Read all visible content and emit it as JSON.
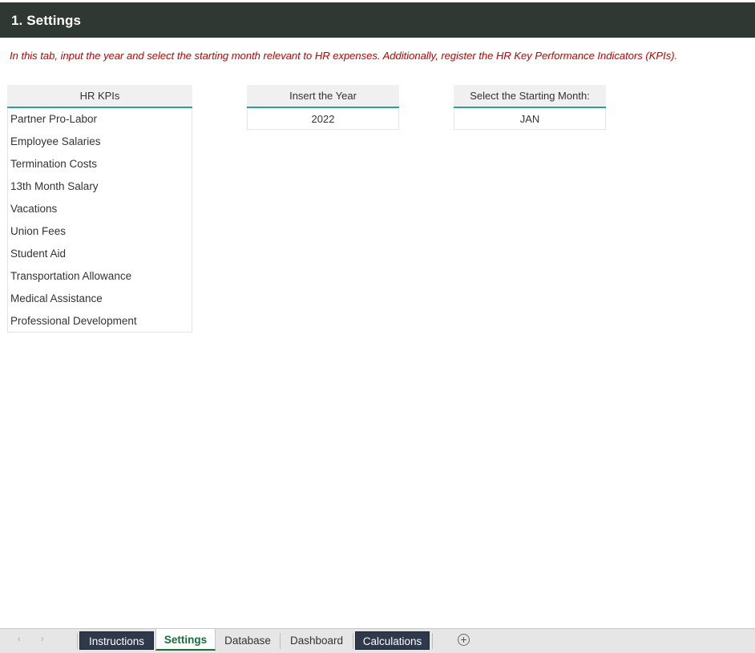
{
  "header": {
    "title": "1. Settings"
  },
  "instructions": "In this tab, input the year and select the starting month relevant to HR expenses. Additionally, register the HR Key Performance Indicators (KPIs).",
  "kpi_table": {
    "header": "HR KPIs",
    "items": [
      "Partner Pro-Labor",
      "Employee Salaries",
      "Termination Costs",
      "13th Month Salary",
      "Vacations",
      "Union Fees",
      "Student Aid",
      "Transportation Allowance",
      "Medical Assistance",
      "Professional Development"
    ]
  },
  "year_field": {
    "header": "Insert the Year",
    "value": "2022"
  },
  "month_field": {
    "header": "Select the Starting Month:",
    "value": "JAN"
  },
  "sheet_tabs": {
    "nav_prev": "‹",
    "nav_next": "›",
    "tabs": [
      "Instructions",
      "Settings",
      "Database",
      "Dashboard",
      "Calculations"
    ],
    "active": "Settings",
    "add_label": "+"
  },
  "colors": {
    "header_bg": "#2f3833",
    "instruction_text": "#c00000",
    "accent_underline": "#2aa0a0",
    "active_tab": "#1e6b3a",
    "dark_tab": "#2e3a4b"
  }
}
